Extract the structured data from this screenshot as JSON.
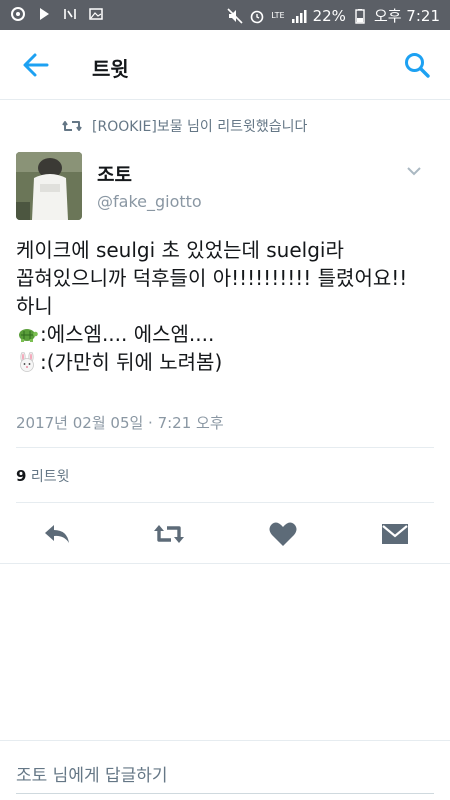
{
  "status_bar": {
    "lte_label": "LTE",
    "battery": "22%",
    "time": "오후 7:21"
  },
  "header": {
    "title": "트윗"
  },
  "retweet_notice": "[ROOKIE]보물 님이 리트윗했습니다",
  "tweet": {
    "author_name": "조토",
    "author_handle": "@fake_giotto",
    "lines": [
      "케이크에 seulgi 초 있었는데 suelgi라",
      "꼽혀있으니까 덕후들이 아!!!!!!!!!! 틀렸어요!!",
      "하니"
    ],
    "line4": ":에스엠.... 에스엠....",
    "line5": ":(가만히 뒤에 노려봄)",
    "timestamp": "2017년 02월 05일 · 7:21 오후",
    "retweet_count": "9",
    "retweet_label": "리트윗"
  },
  "icons": {
    "back": "arrow-left-icon",
    "search": "search-icon",
    "retweet": "retweet-icon",
    "reply": "reply-icon",
    "like": "heart-icon",
    "dm": "mail-icon",
    "turtle": "turtle-emoji",
    "rabbit": "rabbit-emoji"
  },
  "colors": {
    "accent": "#1da1f2",
    "status_bar": "#5b5f66",
    "secondary_text": "#657786",
    "action_icon": "#5d6b78"
  },
  "reply_bar": {
    "placeholder": "조토 님에게 답글하기"
  }
}
